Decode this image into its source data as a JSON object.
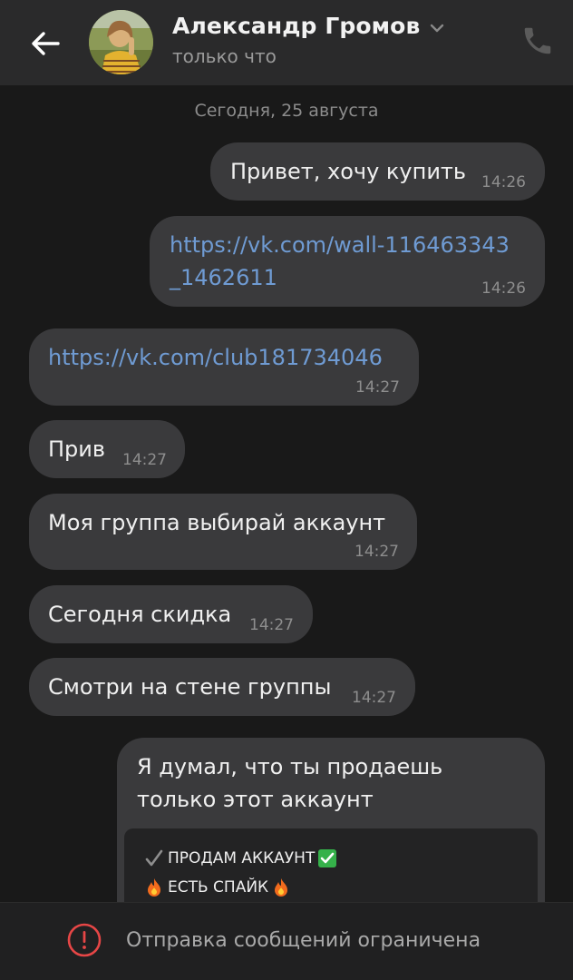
{
  "header": {
    "contact_name": "Александр Громов",
    "status": "только что"
  },
  "chat": {
    "date_separator": "Сегодня, 25 августа",
    "messages": [
      {
        "side": "out",
        "text": "Привет, хочу купить",
        "time": "14:26"
      },
      {
        "side": "out",
        "text_line1": "https://vk.com/wall-116463343",
        "text_line2": "_1462611",
        "time": "14:26",
        "is_link": true
      },
      {
        "side": "in",
        "text": "https://vk.com/club181734046",
        "time": "14:27",
        "is_link": true
      },
      {
        "side": "in",
        "text": "Прив",
        "time": "14:27"
      },
      {
        "side": "in",
        "text": "Моя группа выбирай аккаунт",
        "time": "14:27"
      },
      {
        "side": "in",
        "text": "Сегодня скидка",
        "time": "14:27"
      },
      {
        "side": "in",
        "text": "Смотри на стене группы",
        "time": "14:27"
      },
      {
        "side": "out",
        "text_line1": "Я думал, что ты продаешь",
        "text_line2": "только этот аккаунт",
        "repost": {
          "line1": "ПРОДАМ АККАУНТ",
          "line2": "ЕСТЬ СПАЙК"
        }
      }
    ]
  },
  "restriction": {
    "text": "Отправка сообщений ограничена"
  },
  "colors": {
    "background": "#191919",
    "header": "#2a2a2b",
    "bubble": "#3a3a3c",
    "link": "#6f9bd3",
    "warning": "#e64646"
  },
  "icons": {
    "back": "arrow-left-icon",
    "dropdown": "chevron-down-icon",
    "call": "phone-icon",
    "warning": "exclamation-circle-icon"
  }
}
